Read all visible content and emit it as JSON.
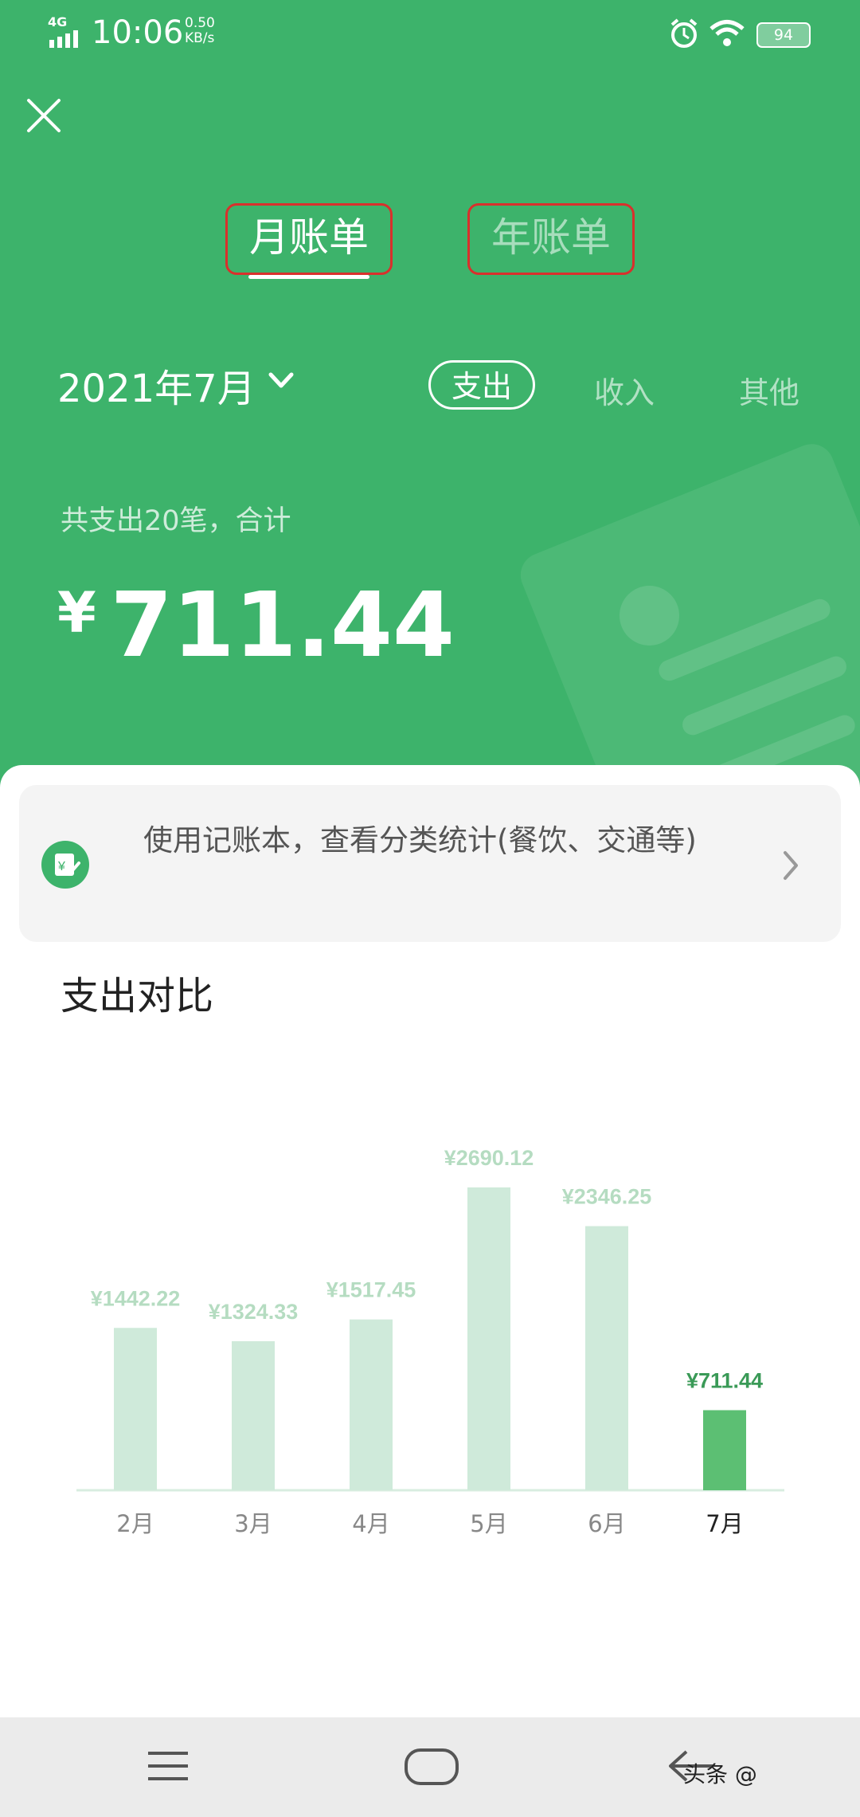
{
  "status_bar": {
    "network": "4G",
    "time": "10:06",
    "speed": "0.50",
    "speed_unit": "KB/s",
    "battery": "94"
  },
  "tabs": [
    {
      "label": "月账单",
      "selected": true
    },
    {
      "label": "年账单",
      "selected": false
    }
  ],
  "month_picker": {
    "label": "2021年7月"
  },
  "filters": [
    {
      "label": "支出",
      "selected": true
    },
    {
      "label": "收入",
      "selected": false
    },
    {
      "label": "其他",
      "selected": false
    }
  ],
  "summary": {
    "text": "共支出20笔，合计",
    "currency": "¥",
    "amount": "711.44"
  },
  "promo": {
    "text": "使用记账本，查看分类统计(餐饮、交通等)"
  },
  "section_title": "支出对比",
  "chart_data": {
    "type": "bar",
    "categories": [
      "2月",
      "3月",
      "4月",
      "5月",
      "6月",
      "7月"
    ],
    "values": [
      1442.22,
      1324.33,
      1517.45,
      2690.12,
      2346.25,
      711.44
    ],
    "value_labels": [
      "¥1442.22",
      "¥1324.33",
      "¥1517.45",
      "¥2690.12",
      "¥2346.25",
      "¥711.44"
    ],
    "highlight_index": 5,
    "bar_color": "#cfeada",
    "highlight_color": "#5cbf73",
    "label_color": "#b5dcc1",
    "highlight_label_color": "#3a9a57"
  },
  "watermark": "头条 @"
}
